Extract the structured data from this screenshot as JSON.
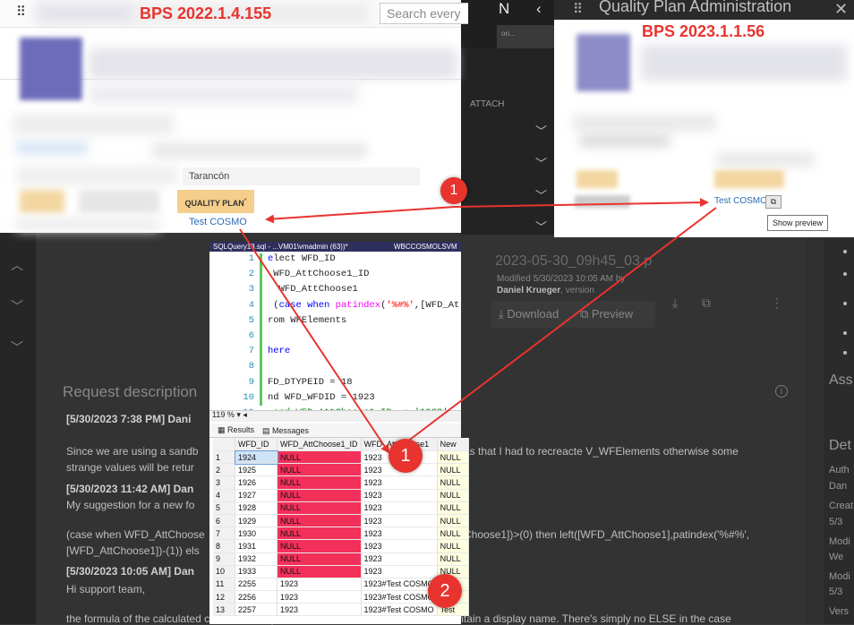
{
  "left_screenshot": {
    "version_label": "BPS 2022.1.4.155",
    "search_placeholder": "Search every",
    "field_value": "Tarancón",
    "quality_plan_tab": "QUALITY PLAN",
    "required_mark": "*",
    "link_text": "Test COSMO"
  },
  "right_screenshot": {
    "app_title": "Quality Plan Administration",
    "version_label": "BPS 2023.1.1.56",
    "link_text": "Test COSMO",
    "tooltip": "Show preview"
  },
  "middle_column": {
    "header_letter": "N",
    "attach_label": "ATTACH"
  },
  "background_ticket": {
    "request_description": "Request description",
    "lines": [
      {
        "text": "[5/30/2023 7:38 PM] Dani",
        "bold": true
      },
      {
        "text": "Since we are using a sandb",
        "bold": false
      },
      {
        "text": "strange values will be retur",
        "bold": false
      },
      {
        "text": "[5/30/2023 11:42 AM] Dan",
        "bold": true
      },
      {
        "text": "My suggestion for a new fo",
        "bold": false
      },
      {
        "text": "(case when WFD_AttChoose",
        "bold": false
      },
      {
        "text": "[WFD_AttChoose1])-(1)) els",
        "bold": false
      },
      {
        "text": "[5/30/2023 10:05 AM] Dan",
        "bold": true
      },
      {
        "text": "Hi support team,",
        "bold": false
      },
      {
        "text": "the formula of the calculated column has a problem. If the choose value doesn't contain a display name. There's simply no ELSE in the case",
        "bold": false
      }
    ],
    "line_tail_1": "as that I had to recreacte V_WFElements otherwise some",
    "line_tail_2": "Choose1])>(0) then left([WFD_AttChoose1],patindex('%#%',",
    "right_sidebar": [
      "Ass",
      "Det",
      "Auth",
      "Dan",
      "Creat",
      "5/3",
      "Modi",
      "We",
      "Modi",
      "5/3",
      "Vers"
    ]
  },
  "file_card": {
    "file_name": "2023-05-30_09h45_03.p",
    "modified": "Modified 5/30/2023 10:05 AM by",
    "author": "Daniel Krueger",
    "version": ", version",
    "download_label": "Download",
    "preview_label": "Preview"
  },
  "sql_editor": {
    "tab_left": "SQLQuery13.sql - ...VM01\\vmadmin (63))*",
    "tab_right": "WBCCOSMOLSVM",
    "zoom": "119 %",
    "results_tab": "Results",
    "messages_tab": "Messages",
    "code_lines": [
      {
        "n": "1",
        "text": "elect WFD_ID"
      },
      {
        "n": "2",
        "text": " WFD_AttChoose1_ID"
      },
      {
        "n": "3",
        "text": "  WFD_AttChoose1"
      },
      {
        "n": "4",
        "text": " (case when patindex('%#%',[WFD_At"
      },
      {
        "n": "5",
        "text": "rom WFElements"
      },
      {
        "n": "6",
        "text": ""
      },
      {
        "n": "7",
        "text": "here"
      },
      {
        "n": "8",
        "text": ""
      },
      {
        "n": "9",
        "text": "FD_DTYPEID = 18"
      },
      {
        "n": "10",
        "text": "nd WFD_WFDID = 1923"
      },
      {
        "n": "11",
        "text": "-and WFD_AttChoose1_ID  = '1923'"
      }
    ],
    "columns": [
      "",
      "WFD_ID",
      "WFD_AttChoose1_ID",
      "WFD_AttChoose1",
      "New"
    ],
    "rows": [
      [
        "1",
        "1924",
        "NULL",
        "1923",
        "NULL"
      ],
      [
        "2",
        "1925",
        "NULL",
        "1923",
        "NULL"
      ],
      [
        "3",
        "1926",
        "NULL",
        "1923",
        "NULL"
      ],
      [
        "4",
        "1927",
        "NULL",
        "1923",
        "NULL"
      ],
      [
        "5",
        "1928",
        "NULL",
        "1923",
        "NULL"
      ],
      [
        "6",
        "1929",
        "NULL",
        "1923",
        "NULL"
      ],
      [
        "7",
        "1930",
        "NULL",
        "1923",
        "NULL"
      ],
      [
        "8",
        "1931",
        "NULL",
        "1923",
        "NULL"
      ],
      [
        "9",
        "1932",
        "NULL",
        "1923",
        "NULL"
      ],
      [
        "10",
        "1933",
        "NULL",
        "1923",
        "NULL"
      ],
      [
        "11",
        "2255",
        "1923",
        "1923#Test COSMO",
        "Test"
      ],
      [
        "12",
        "2256",
        "1923",
        "1923#Test COSMO",
        "Test"
      ],
      [
        "13",
        "2257",
        "1923",
        "1923#Test COSMO",
        "Test"
      ]
    ]
  },
  "annotations": {
    "badge_1": "1",
    "badge_2": "2",
    "color": "#e8332e"
  }
}
